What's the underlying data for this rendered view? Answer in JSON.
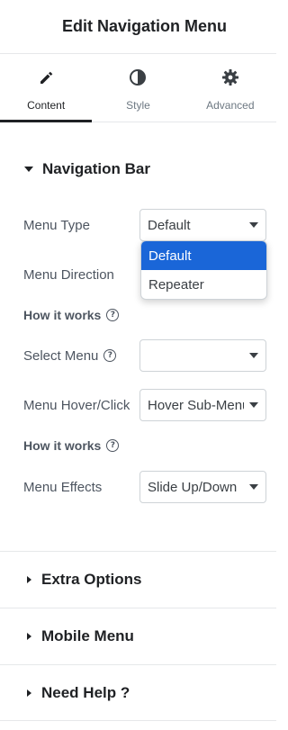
{
  "header": {
    "title": "Edit Navigation Menu"
  },
  "tabs": [
    {
      "label": "Content",
      "icon": "pencil-icon",
      "active": true
    },
    {
      "label": "Style",
      "icon": "contrast-icon",
      "active": false
    },
    {
      "label": "Advanced",
      "icon": "gear-icon",
      "active": false
    }
  ],
  "section": {
    "title": "Navigation Bar"
  },
  "fields": {
    "menu_type": {
      "label": "Menu Type",
      "value": "Default"
    },
    "menu_direction": {
      "label": "Menu Direction"
    },
    "how_it_works_1": {
      "label": "How it works"
    },
    "select_menu": {
      "label": "Select Menu",
      "value": ""
    },
    "menu_hover": {
      "label": "Menu Hover/Click",
      "value": "Hover Sub-Menu"
    },
    "how_it_works_2": {
      "label": "How it works"
    },
    "menu_effects": {
      "label": "Menu Effects",
      "value": "Slide Up/Down"
    }
  },
  "dropdown": {
    "options": [
      "Default",
      "Repeater"
    ],
    "selected": "Default"
  },
  "collapsed_sections": [
    "Extra Options",
    "Mobile Menu",
    "Need Help ?"
  ],
  "colors": {
    "accent": "#1a66d8",
    "text": "#1f2124",
    "muted": "#6d7882"
  }
}
